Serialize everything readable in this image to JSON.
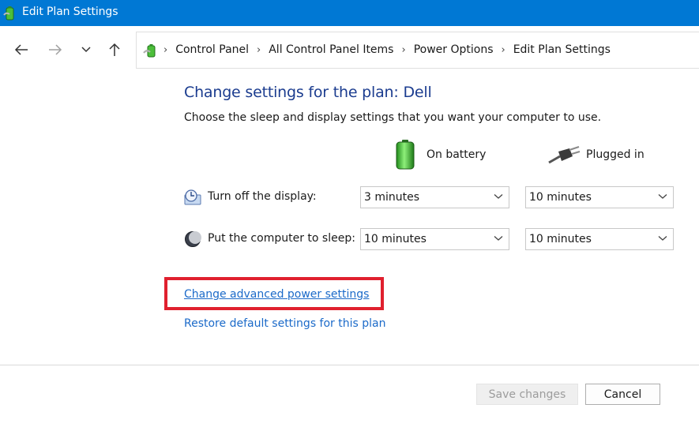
{
  "window": {
    "title": "Edit Plan Settings",
    "app_icon": "power-options-icon"
  },
  "nav": {
    "back_icon": "arrow-left-icon",
    "forward_icon": "arrow-right-icon",
    "recent_icon": "chevron-down-icon",
    "up_icon": "arrow-up-icon"
  },
  "breadcrumb": [
    {
      "label": "Control Panel"
    },
    {
      "label": "All Control Panel Items"
    },
    {
      "label": "Power Options"
    },
    {
      "label": "Edit Plan Settings"
    }
  ],
  "main": {
    "heading": "Change settings for the plan: Dell",
    "subtitle": "Choose the sleep and display settings that you want your computer to use.",
    "columns": {
      "on_battery": "On battery",
      "plugged_in": "Plugged in"
    },
    "settings": [
      {
        "label": "Turn off the display:",
        "icon": "display-timer-icon",
        "on_battery": "3 minutes",
        "plugged_in": "10 minutes"
      },
      {
        "label": "Put the computer to sleep:",
        "icon": "sleep-moon-icon",
        "on_battery": "10 minutes",
        "plugged_in": "10 minutes"
      }
    ],
    "links": {
      "advanced": "Change advanced power settings",
      "restore": "Restore default settings for this plan"
    },
    "highlight_color": "#e0202e"
  },
  "footer": {
    "save_label": "Save changes",
    "cancel_label": "Cancel"
  },
  "colors": {
    "titlebar": "#0078d4",
    "heading": "#1b3c8f",
    "link": "#1b6ac9"
  }
}
